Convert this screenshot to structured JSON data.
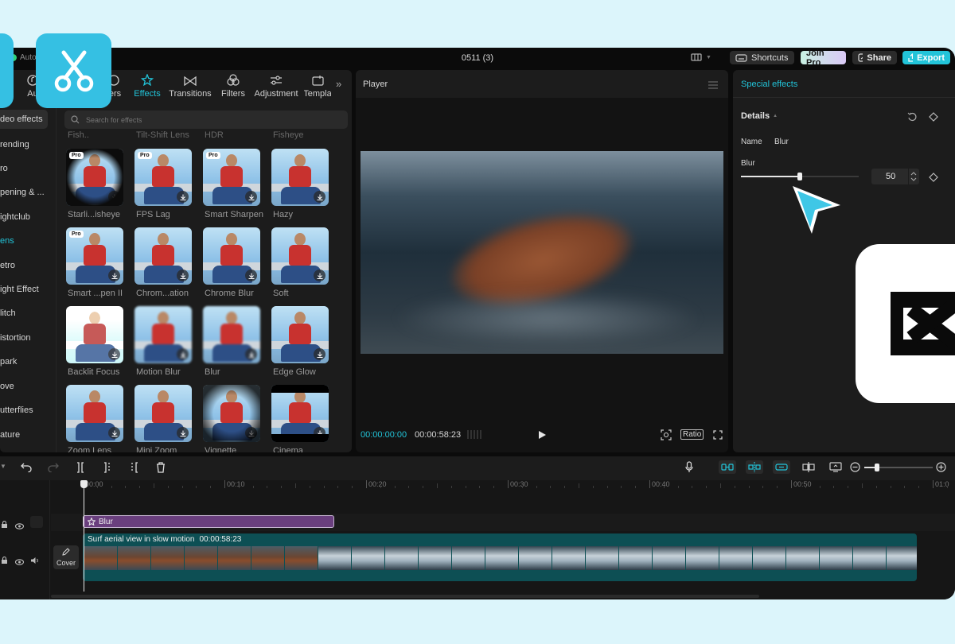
{
  "app": {
    "autosave": "Auto",
    "project_title": "0511 (3)"
  },
  "header": {
    "shortcuts_label": "Shortcuts",
    "join_pro_label": "Join Pro",
    "share_label": "Share",
    "export_label": "Export"
  },
  "tabs": [
    {
      "label": "Audio",
      "display": "Au"
    },
    {
      "label": "Stickers",
      "display": "ters"
    },
    {
      "label": "Effects",
      "display": "Effects"
    },
    {
      "label": "Transitions",
      "display": "Transitions"
    },
    {
      "label": "Filters",
      "display": "Filters"
    },
    {
      "label": "Adjustment",
      "display": "Adjustment"
    },
    {
      "label": "Templates",
      "display": "Templa"
    }
  ],
  "categories": [
    {
      "label": "Video effects",
      "display": "deo effects",
      "active": true
    },
    {
      "label": "Trending",
      "display": "rending"
    },
    {
      "label": "Pro",
      "display": "ro"
    },
    {
      "label": "Opening & ...",
      "display": "pening & ..."
    },
    {
      "label": "Nightclub",
      "display": "ightclub"
    },
    {
      "label": "Lens",
      "display": "ens",
      "selected": true
    },
    {
      "label": "Retro",
      "display": "etro"
    },
    {
      "label": "Light Effect",
      "display": "ight Effect"
    },
    {
      "label": "Glitch",
      "display": "litch"
    },
    {
      "label": "Distortion",
      "display": "istortion"
    },
    {
      "label": "Spark",
      "display": "park"
    },
    {
      "label": "Love",
      "display": "ove"
    },
    {
      "label": "Butterflies",
      "display": "utterflies"
    },
    {
      "label": "Nature",
      "display": "ature"
    }
  ],
  "search": {
    "placeholder": "Search for effects"
  },
  "partial_row": [
    "Fish..",
    "Tilt-Shift Lens",
    "HDR",
    "Fisheye"
  ],
  "effects": [
    {
      "name": "Starli...isheye",
      "pro": true
    },
    {
      "name": "FPS Lag",
      "pro": true
    },
    {
      "name": "Smart Sharpen",
      "pro": true
    },
    {
      "name": "Hazy",
      "pro": false
    },
    {
      "name": "Smart ...pen II",
      "pro": true
    },
    {
      "name": "Chrom...ation",
      "pro": false
    },
    {
      "name": "Chrome Blur",
      "pro": false
    },
    {
      "name": "Soft",
      "pro": false
    },
    {
      "name": "Backlit Focus",
      "pro": false
    },
    {
      "name": "Motion Blur",
      "pro": false
    },
    {
      "name": "Blur",
      "pro": false
    },
    {
      "name": "Edge Glow",
      "pro": false
    },
    {
      "name": "Zoom Lens",
      "pro": false
    },
    {
      "name": "Mini Zoom",
      "pro": false
    },
    {
      "name": "Vignette",
      "pro": false
    },
    {
      "name": "Cinema",
      "pro": false
    }
  ],
  "pro_badge": "Pro",
  "player": {
    "title": "Player",
    "current_time": "00:00:00:00",
    "total_time": "00:00:58:23",
    "ratio_label": "Ratio"
  },
  "inspector": {
    "title": "Special effects",
    "details_label": "Details",
    "name_label": "Name",
    "name_value": "Blur",
    "blur_label": "Blur",
    "blur_value": "50",
    "blur_fraction": 0.5
  },
  "timeline": {
    "ruler": [
      "00:00",
      "00:10",
      "00:20",
      "00:30",
      "00:40",
      "00:50",
      "01:0"
    ],
    "effect_clip_label": "Blur",
    "video_clip_title": "Surf aerial view in slow motion",
    "video_clip_duration": "00:00:58:23",
    "cover_label": "Cover"
  },
  "colors": {
    "accent": "#22c4d9",
    "effect_clip": "#6a3f7e",
    "video_clip": "#0d4f54",
    "brand_tile": "#35c0e3"
  }
}
